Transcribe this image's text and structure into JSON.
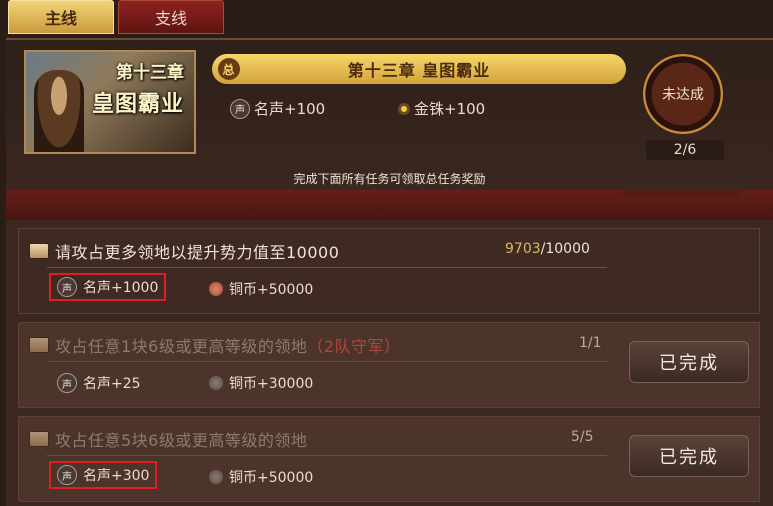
{
  "tabs": [
    {
      "label": "主线",
      "active": true
    },
    {
      "label": "支线",
      "active": false
    }
  ],
  "chapter": {
    "image_line1": "第十三章",
    "image_line2": "皇图霸业",
    "title_badge": "总",
    "title": "第十三章  皇图霸业",
    "rewards": [
      {
        "icon": "fame-icon",
        "icon_text": "声",
        "text": "名声+100"
      },
      {
        "icon": "gold-coin-icon",
        "text": "金铢+100"
      }
    ],
    "status": "未达成",
    "progress": "2/6",
    "notice": "完成下面所有任务可领取总任务奖励"
  },
  "tasks": [
    {
      "title": "请攻占更多领地以提升势力值至10000",
      "count_current": "9703",
      "count_total": "/10000",
      "state": "in-progress",
      "rewards": [
        {
          "icon_text": "声",
          "text": "名声+1000",
          "highlighted": true
        },
        {
          "icon": "copper-coin-icon",
          "text": "铜币+50000"
        }
      ]
    },
    {
      "title_prefix": "攻占任意1块6级或更高等级的领地",
      "title_highlight": "（2队守军）",
      "count": "1/1",
      "state": "done",
      "button": "已完成",
      "rewards": [
        {
          "icon_text": "声",
          "text": "名声+25",
          "highlighted": false
        },
        {
          "icon": "copper-coin-icon",
          "text": "铜币+30000"
        }
      ]
    },
    {
      "title": "攻占任意5块6级或更高等级的领地",
      "count": "5/5",
      "state": "done",
      "button": "已完成",
      "rewards": [
        {
          "icon_text": "声",
          "text": "名声+300",
          "highlighted": true
        },
        {
          "icon": "copper-coin-icon",
          "text": "铜币+50000"
        }
      ]
    }
  ],
  "colors": {
    "accent_gold": "#f2d37a",
    "highlight_red": "#e02020",
    "count_gold": "#d8b860"
  }
}
